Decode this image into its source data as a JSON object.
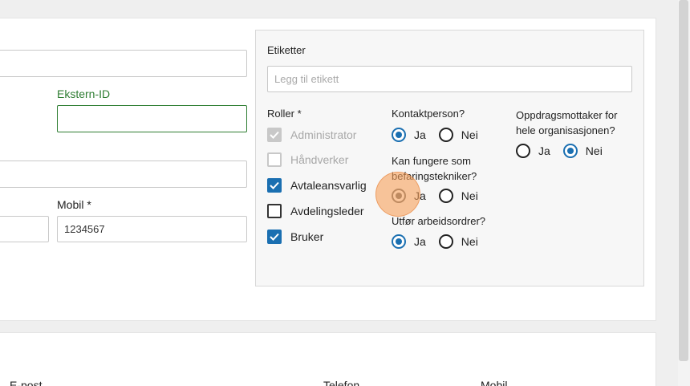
{
  "form": {
    "ekstern_id_label": "Ekstern-ID",
    "ekstern_id_value": "",
    "mobil_label": "Mobil *",
    "mobil_value": "1234567"
  },
  "panel": {
    "etiketter_label": "Etiketter",
    "etiketter_placeholder": "Legg til etikett",
    "roller_label": "Roller *",
    "roles": [
      {
        "label": "Administrator",
        "checked": true,
        "disabled": true
      },
      {
        "label": "Håndverker",
        "checked": false,
        "disabled": true
      },
      {
        "label": "Avtaleansvarlig",
        "checked": true,
        "disabled": false
      },
      {
        "label": "Avdelingsleder",
        "checked": false,
        "disabled": false
      },
      {
        "label": "Bruker",
        "checked": true,
        "disabled": false
      }
    ],
    "kontaktperson": {
      "label": "Kontaktperson?",
      "yes": "Ja",
      "no": "Nei",
      "selected": "Ja"
    },
    "befaring": {
      "label_line1": "Kan fungere som",
      "label_line2": "befaringstekniker?",
      "yes": "Ja",
      "no": "Nei",
      "selected": "Ja"
    },
    "arbeidsordrer": {
      "label": "Utfør arbeidsordrer?",
      "yes": "Ja",
      "no": "Nei",
      "selected": "Ja"
    },
    "oppdragsmottaker": {
      "label_line1": "Oppdragsmottaker for",
      "label_line2": "hele organisasjonen?",
      "yes": "Ja",
      "no": "Nei",
      "selected": "Nei"
    }
  },
  "table": {
    "columns": [
      "E-post",
      "Telefon",
      "Mobil"
    ]
  },
  "colors": {
    "accent": "#1a6fb1",
    "green": "#2e7d32"
  }
}
